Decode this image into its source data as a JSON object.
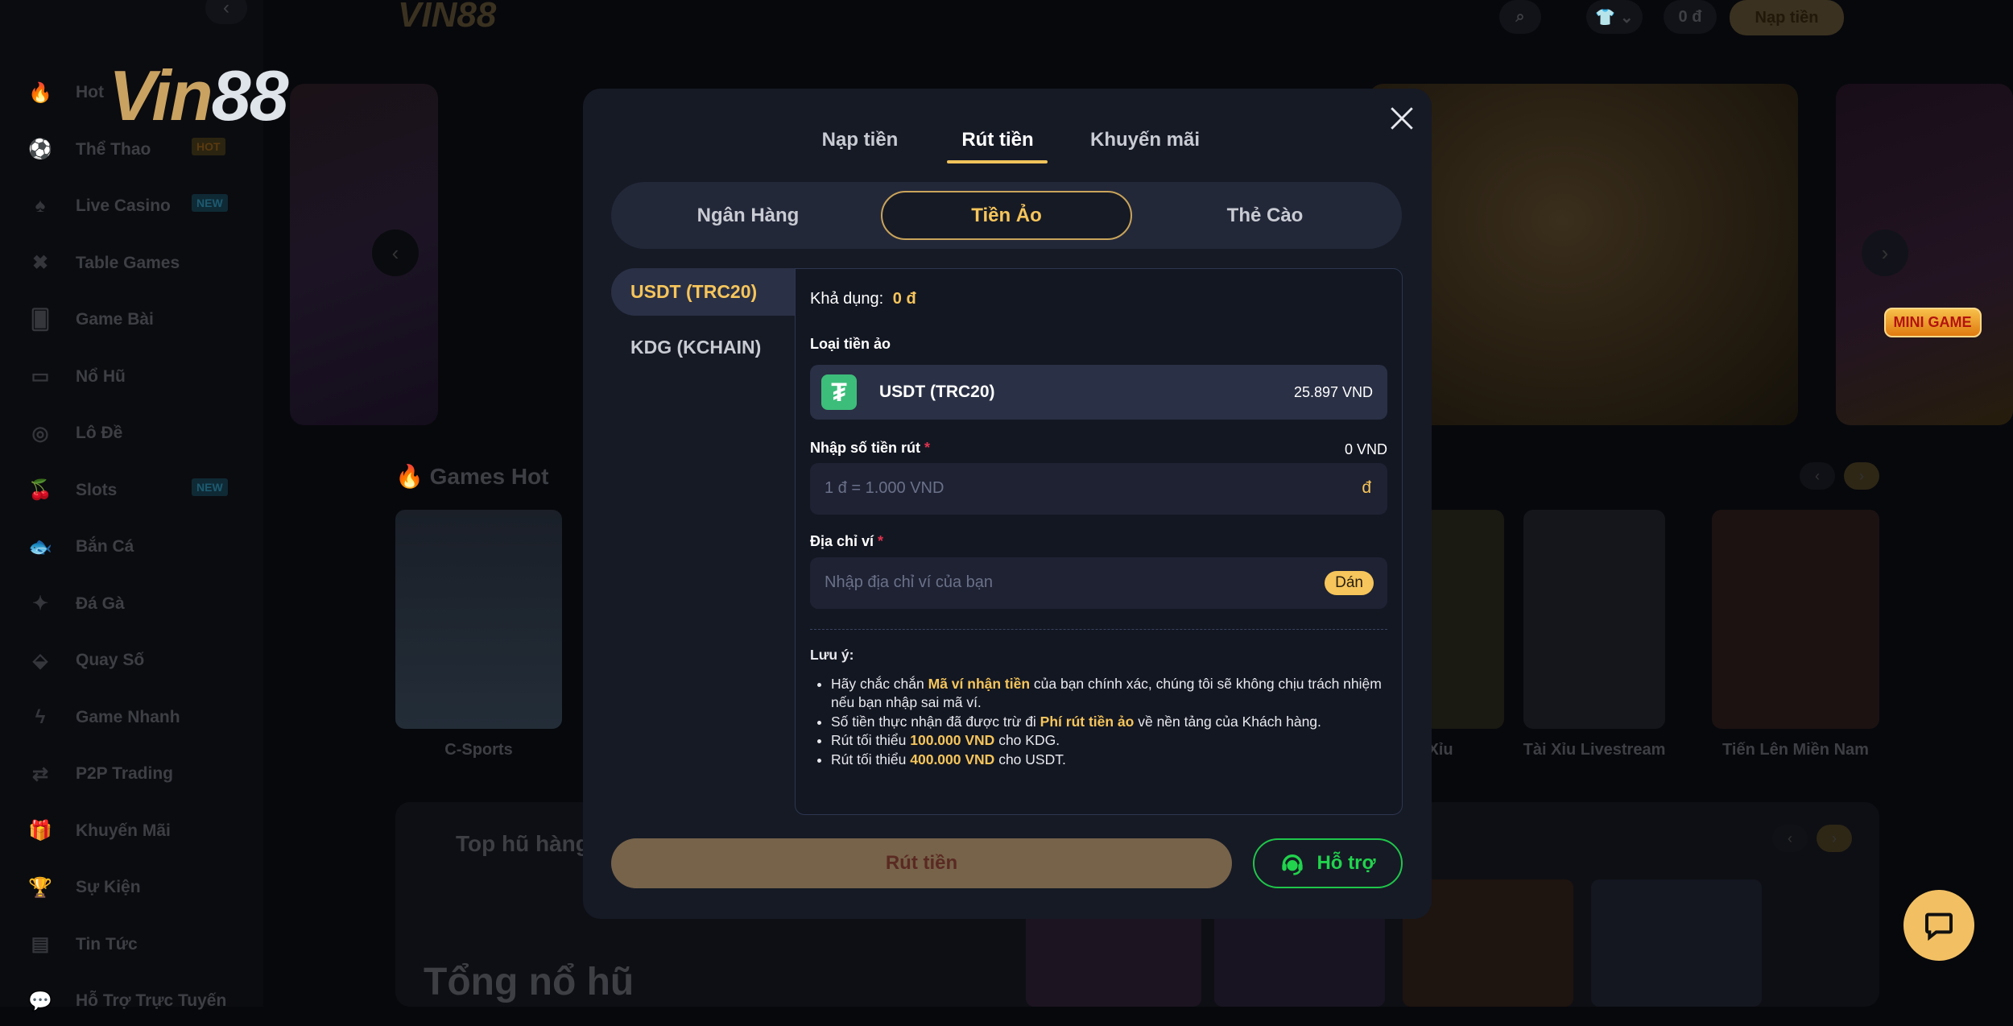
{
  "background": {
    "brand": "VIN88",
    "topbar": {
      "balance": "0 đ",
      "deposit_label": "Nạp tiền"
    },
    "sidebar": [
      {
        "label": "Hot",
        "icon": "fire-icon"
      },
      {
        "label": "Thể Thao",
        "icon": "soccer-ball-icon",
        "badge": "HOT"
      },
      {
        "label": "Live Casino",
        "icon": "spade-icon",
        "badge": "NEW"
      },
      {
        "label": "Table Games",
        "icon": "table-games-icon"
      },
      {
        "label": "Game Bài",
        "icon": "cards-icon"
      },
      {
        "label": "Nổ Hũ",
        "icon": "slot-777-icon"
      },
      {
        "label": "Lô Đề",
        "icon": "ball-8-icon"
      },
      {
        "label": "Slots",
        "icon": "cherry-icon",
        "badge": "NEW"
      },
      {
        "label": "Bắn Cá",
        "icon": "fish-icon"
      },
      {
        "label": "Đá Gà",
        "icon": "rooster-icon"
      },
      {
        "label": "Quay Số",
        "icon": "dice-icon"
      },
      {
        "label": "Game Nhanh",
        "icon": "lightning-icon"
      },
      {
        "label": "P2P Trading",
        "icon": "p2p-icon"
      },
      {
        "label": "Khuyến Mãi",
        "icon": "gift-icon"
      },
      {
        "label": "Sự Kiện",
        "icon": "trophy-icon"
      },
      {
        "label": "Tin Tức",
        "icon": "news-icon"
      },
      {
        "label": "Hỗ Trợ Trực Tuyến",
        "icon": "chat-support-icon"
      }
    ],
    "games_hot_title": "Games Hot",
    "games": [
      "C-Sports",
      "Xỉu",
      "Tài Xỉu Livestream",
      "Tiến Lên Miền Nam"
    ],
    "top_hu_title": "Top hũ hàng",
    "tong_no_hu": "Tổng nổ hũ",
    "mini_game": "MINI GAME"
  },
  "modal": {
    "tabs": [
      "Nạp tiền",
      "Rút tiền",
      "Khuyến mãi"
    ],
    "active_tab": "Rút tiền",
    "subtabs": [
      "Ngân Hàng",
      "Tiền Ảo",
      "Thẻ Cào"
    ],
    "active_subtab": "Tiền Ảo",
    "coins": [
      "USDT (TRC20)",
      "KDG (KCHAIN)"
    ],
    "active_coin": "USDT (TRC20)",
    "available_label": "Khả dụng:",
    "available_value": "0 đ",
    "coin_type_label": "Loại tiền ảo",
    "selected_coin": {
      "name": "USDT (TRC20)",
      "rate": "25.897 VND",
      "icon": "tether-icon"
    },
    "amount_label": "Nhập số tiền rút",
    "amount_converted": "0 VND",
    "amount_placeholder": "1 đ = 1.000 VND",
    "amount_suffix": "đ",
    "wallet_label": "Địa chỉ ví",
    "wallet_placeholder": "Nhập địa chỉ ví của bạn",
    "paste_label": "Dán",
    "notes_title": "Lưu ý:",
    "notes": [
      {
        "pre": "Hãy chắc chắn ",
        "hl": "Mã ví nhận tiền",
        "post": " của bạn chính xác, chúng tôi sẽ không chịu trách nhiệm nếu bạn nhập sai mã ví."
      },
      {
        "pre": "Số tiền thực nhận đã được trừ đi ",
        "hl": "Phí rút tiền ảo",
        "post": " về nền tảng của Khách hàng."
      },
      {
        "pre": "Rút tối thiểu ",
        "hl": "100.000 VND",
        "post": " cho KDG."
      },
      {
        "pre": "Rút tối thiểu ",
        "hl": "400.000 VND",
        "post": " cho USDT."
      }
    ],
    "withdraw_button": "Rút tiền",
    "support_button": "Hỗ trợ"
  },
  "colors": {
    "accent": "#f6c55b",
    "support_green": "#21d34d",
    "modal_bg": "#161a25"
  }
}
